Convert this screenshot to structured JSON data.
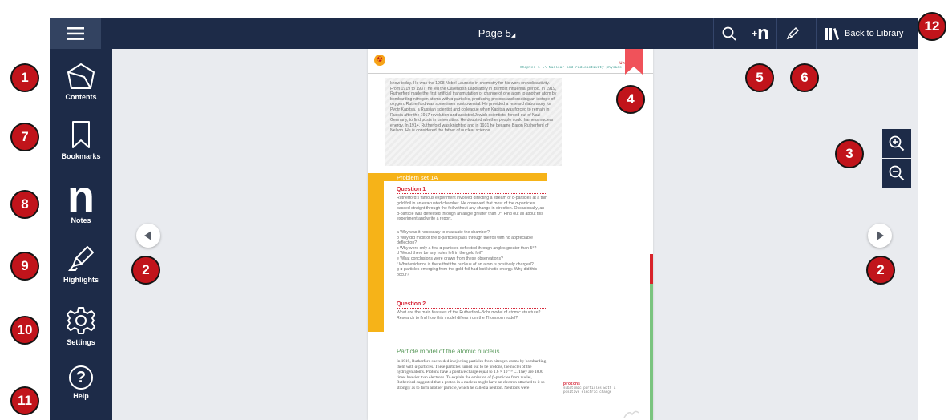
{
  "topbar": {
    "page_label": "Page 5",
    "back_to_library": "Back to Library",
    "icons": [
      "menu-icon",
      "search-icon",
      "add-note-icon",
      "highlight-pen-icon",
      "library-icon"
    ]
  },
  "sidebar": {
    "items": [
      {
        "label": "Contents",
        "icon": "contents-icon"
      },
      {
        "label": "Bookmarks",
        "icon": "bookmark-icon"
      },
      {
        "label": "Notes",
        "icon": "notes-icon",
        "glyph": "n"
      },
      {
        "label": "Highlights",
        "icon": "highlighter-icon"
      },
      {
        "label": "Settings",
        "icon": "gear-icon"
      },
      {
        "label": "Help",
        "icon": "help-icon",
        "glyph": "?"
      }
    ]
  },
  "page": {
    "unit_header": "Unit 1",
    "chapter_header": "Chapter 1 \\\\ Nuclear and radioactivity physics",
    "intro_paragraph": "know today. He was the 1908 Nobel Laureate in chemistry for his work on radioactivity. From 1919 to 1937, he led the Cavendish Laboratory in its most influential period. In 1919, Rutherford made the first artificial transmutation or change of one atom to another atom by bombarding nitrogen atoms with α-particles, producing protons and creating an isotope of oxygen. Rutherford was sometimes controversial. He provided a research laboratory for Pyotr Kapitsa, a Russian scientist and colleague when Kapitsa was forced to remain in Russia after the 1917 revolution and assisted Jewish scientists, forced out of Nazi Germany, to find posts in universities. He doubted whether people could harness nuclear energy. In 1914, Rutherford was knighted and in 1931 he became Baron Rutherford of Nelson. He is considered the father of nuclear science.",
    "problem_set_title": "Problem set 1A",
    "question1_title": "Question 1",
    "question1_text": "Rutherford's famous experiment involved directing a stream of α-particles at a thin gold foil in an evacuated chamber. He observed that most of the α-particles passed straight through the foil without any change in direction. Occasionally, an α-particle was deflected through an angle greater than 0°. Find out all about this experiment and write a report.",
    "question1_items": [
      "a  Why was it necessary to evacuate the chamber?",
      "b  Why did most of the α-particles pass through the foil with no appreciable deflection?",
      "c  Why were only a few α-particles deflected through angles greater than 5°?",
      "d  Would there be any holes left in the gold foil?",
      "e  What conclusions were drawn from these observations?",
      "f  What evidence is there that the nucleus of an atom is positively charged?",
      "g  α-particles emerging from the gold foil had lost kinetic energy. Why did this occur?"
    ],
    "question2_title": "Question 2",
    "question2_text": "What are the main features of the Rutherford–Bohr model of atomic structure? Research to find how this model differs from the Thomson model?",
    "section_title": "Particle model of the atomic nucleus",
    "section_text": "In 1919, Rutherford succeeded in ejecting particles from nitrogen atoms by bombarding them with α-particles. These particles turned out to be protons, the nuclei of the hydrogen atoms. Protons have a positive charge equal to 1.6 × 10⁻¹⁹ C. They are 1800 times heavier than electrons. To explain the emission of β-particles from nuclei, Rutherford suggested that a proton in a nucleus might have an electron attached to it so strongly as to form another particle, which he called a neutron. Neutrons were",
    "glossary_term": "protons",
    "glossary_def": "subatomic particles with a positive electric charge"
  },
  "callouts": [
    "1",
    "2",
    "2",
    "3",
    "4",
    "5",
    "6",
    "7",
    "8",
    "9",
    "10",
    "11",
    "12"
  ],
  "colors": {
    "navy": "#1d2b48",
    "badge_red": "#c1141b",
    "problem_orange": "#f6b318",
    "heading_red": "#d6293a",
    "section_green": "#5b9a5d",
    "progress_red": "#d8232a",
    "progress_green": "#7bc47f"
  }
}
